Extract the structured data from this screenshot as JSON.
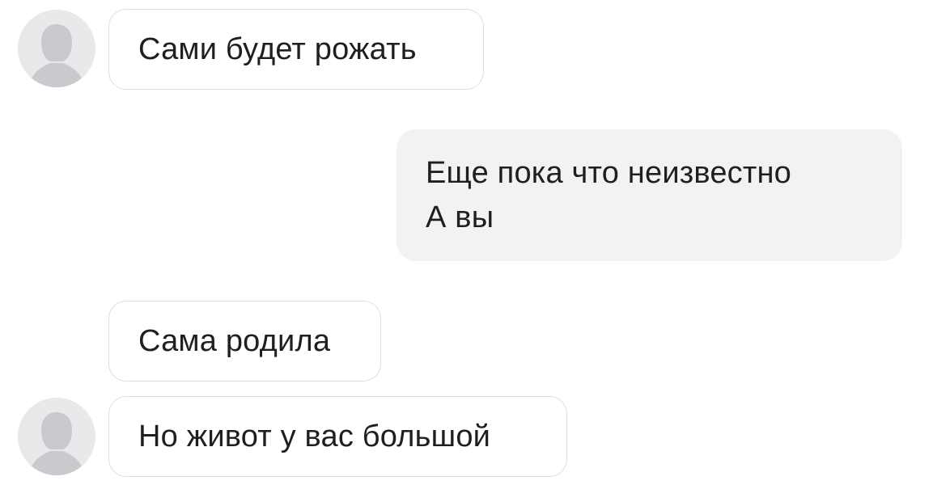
{
  "chat": {
    "messages": [
      {
        "direction": "incoming",
        "sender_avatar": "default-female-avatar-icon",
        "text": "Сами будет рожать"
      },
      {
        "direction": "outgoing",
        "text": "Еще пока что неизвестно\nА вы"
      },
      {
        "direction": "incoming",
        "text": "Сама родила"
      },
      {
        "direction": "incoming",
        "sender_avatar": "default-female-avatar-icon",
        "text": "Но живот у вас большой"
      }
    ]
  },
  "colors": {
    "background": "#ffffff",
    "incoming_bubble_border": "#dcdee2",
    "outgoing_bubble_bg": "#f1f2f4",
    "avatar_bg": "#e8e9eb",
    "avatar_silhouette": "#c8cacd",
    "text": "#1f1f1f"
  }
}
